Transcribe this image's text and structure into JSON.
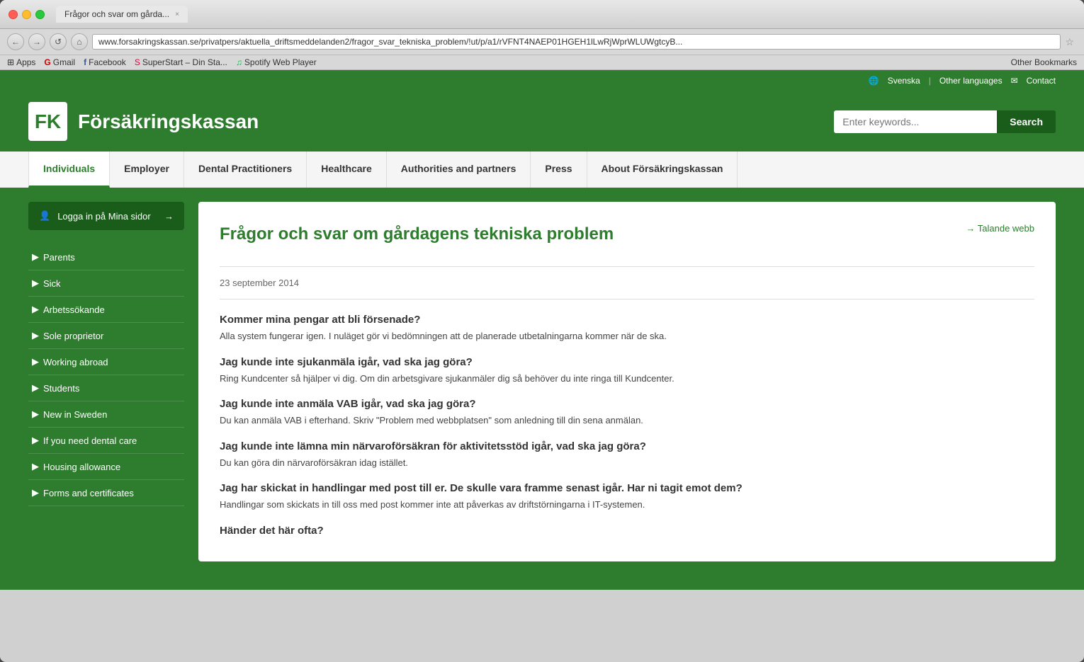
{
  "browser": {
    "tab_title": "Frågor och svar om gårda...",
    "tab_close": "×",
    "url": "www.forsakringskassan.se/privatpers/aktuella_driftsmeddelanden2/fragor_svar_tekniska_problem/!ut/p/a1/rVFNT4NAEP01HGEH1lLwRjWprWLUWgtcyB...",
    "nav_back": "←",
    "nav_forward": "→",
    "nav_refresh": "↺",
    "nav_home": "⌂",
    "bookmarks": [
      "Apps",
      "Gmail",
      "Facebook",
      "SuperStart – Din Sta...",
      "Spotify Web Player"
    ],
    "other_bookmarks": "Other Bookmarks"
  },
  "topbar": {
    "globe_icon": "🌐",
    "svenska": "Svenska",
    "other_languages": "Other languages",
    "email_icon": "✉",
    "contact": "Contact"
  },
  "header": {
    "logo_text": "FK",
    "site_name": "Försäkringskassan",
    "search_placeholder": "Enter keywords...",
    "search_btn": "Search"
  },
  "nav": {
    "items": [
      {
        "id": "individuals",
        "label": "Individuals",
        "active": true
      },
      {
        "id": "employer",
        "label": "Employer",
        "active": false
      },
      {
        "id": "dental",
        "label": "Dental Practitioners",
        "active": false
      },
      {
        "id": "healthcare",
        "label": "Healthcare",
        "active": false
      },
      {
        "id": "authorities",
        "label": "Authorities and partners",
        "active": false
      },
      {
        "id": "press",
        "label": "Press",
        "active": false
      },
      {
        "id": "about",
        "label": "About Försäkringskassan",
        "active": false
      }
    ]
  },
  "sidebar": {
    "login_btn": "Logga in på Mina sidor",
    "login_icon": "👤",
    "login_arrow": "→",
    "menu_items": [
      {
        "id": "parents",
        "label": "Parents"
      },
      {
        "id": "sick",
        "label": "Sick"
      },
      {
        "id": "arbetssokande",
        "label": "Arbetssökande"
      },
      {
        "id": "sole",
        "label": "Sole proprietor"
      },
      {
        "id": "working-abroad",
        "label": "Working abroad"
      },
      {
        "id": "students",
        "label": "Students"
      },
      {
        "id": "new-in-sweden",
        "label": "New in Sweden"
      },
      {
        "id": "dental",
        "label": "If you need dental care"
      },
      {
        "id": "housing",
        "label": "Housing allowance"
      },
      {
        "id": "forms",
        "label": "Forms and certificates"
      }
    ]
  },
  "main": {
    "title": "Frågor och svar om gårdagens tekniska problem",
    "talande_webb": "Talande webb",
    "date": "23 september 2014",
    "faqs": [
      {
        "question": "Kommer mina pengar att bli försenade?",
        "answer": "Alla system fungerar igen. I nuläget gör vi bedömningen att de planerade utbetalningarna kommer när de ska."
      },
      {
        "question": "Jag kunde inte sjukanmäla igår, vad ska jag göra?",
        "answer": "Ring Kundcenter så hjälper vi dig. Om din arbetsgivare sjukanmäler dig så behöver du inte ringa till Kundcenter."
      },
      {
        "question": "Jag kunde inte anmäla VAB igår, vad ska jag göra?",
        "answer": "Du kan anmäla VAB i efterhand. Skriv \"Problem med webbplatsen\" som anledning till din sena anmälan."
      },
      {
        "question": "Jag kunde inte lämna min närvaroförsäkran för aktivitetsstöd igår, vad ska jag göra?",
        "answer": "Du kan göra din närvaroförsäkran idag istället."
      },
      {
        "question": "Jag har skickat in handlingar med post till er. De skulle vara framme senast igår. Har ni tagit emot dem?",
        "answer": "Handlingar som skickats in till oss med post kommer inte att påverkas av driftstörningarna i IT-systemen."
      },
      {
        "question": "Händer det här ofta?",
        "answer": ""
      }
    ]
  }
}
